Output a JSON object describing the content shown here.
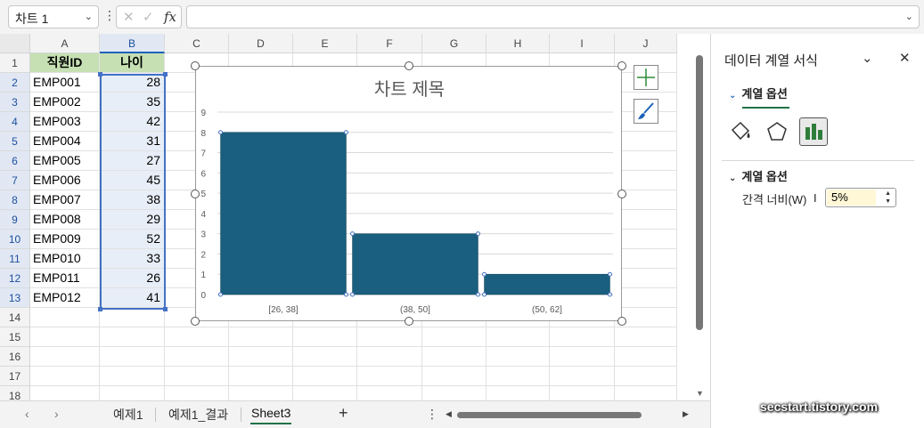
{
  "formula_bar": {
    "name_box": "차트 1",
    "formula": ""
  },
  "grid": {
    "columns": [
      "A",
      "B",
      "C",
      "D",
      "E",
      "F",
      "G",
      "H",
      "I",
      "J"
    ],
    "rows": [
      "1",
      "2",
      "3",
      "4",
      "5",
      "6",
      "7",
      "8",
      "9",
      "10",
      "11",
      "12",
      "13",
      "14",
      "15",
      "16",
      "17",
      "18"
    ],
    "header": {
      "a": "직원ID",
      "b": "나이"
    },
    "data": [
      {
        "id": "EMP001",
        "age": "28"
      },
      {
        "id": "EMP002",
        "age": "35"
      },
      {
        "id": "EMP003",
        "age": "42"
      },
      {
        "id": "EMP004",
        "age": "31"
      },
      {
        "id": "EMP005",
        "age": "27"
      },
      {
        "id": "EMP006",
        "age": "45"
      },
      {
        "id": "EMP007",
        "age": "38"
      },
      {
        "id": "EMP008",
        "age": "29"
      },
      {
        "id": "EMP009",
        "age": "52"
      },
      {
        "id": "EMP010",
        "age": "33"
      },
      {
        "id": "EMP011",
        "age": "26"
      },
      {
        "id": "EMP012",
        "age": "41"
      }
    ]
  },
  "chart": {
    "title": "차트 제목",
    "bar_color": "#1a5f7f"
  },
  "chart_data": {
    "type": "bar",
    "title": "차트 제목",
    "categories": [
      "[26, 38]",
      "(38, 50]",
      "(50, 62]"
    ],
    "values": [
      8,
      3,
      1
    ],
    "ylim": [
      0,
      9
    ],
    "yticks": [
      0,
      1,
      2,
      3,
      4,
      5,
      6,
      7,
      8,
      9
    ],
    "grid": true,
    "gap_width_percent": 5
  },
  "pane": {
    "title": "데이터 계열 서식",
    "tab": "계열 옵션",
    "section": "계열 옵션",
    "gap_label": "간격 너비(W)",
    "gap_value": "5%"
  },
  "sheets": {
    "tabs": [
      "예제1",
      "예제1_결과",
      "Sheet3"
    ],
    "active": "Sheet3"
  },
  "watermark": "secstart.tistory.com"
}
